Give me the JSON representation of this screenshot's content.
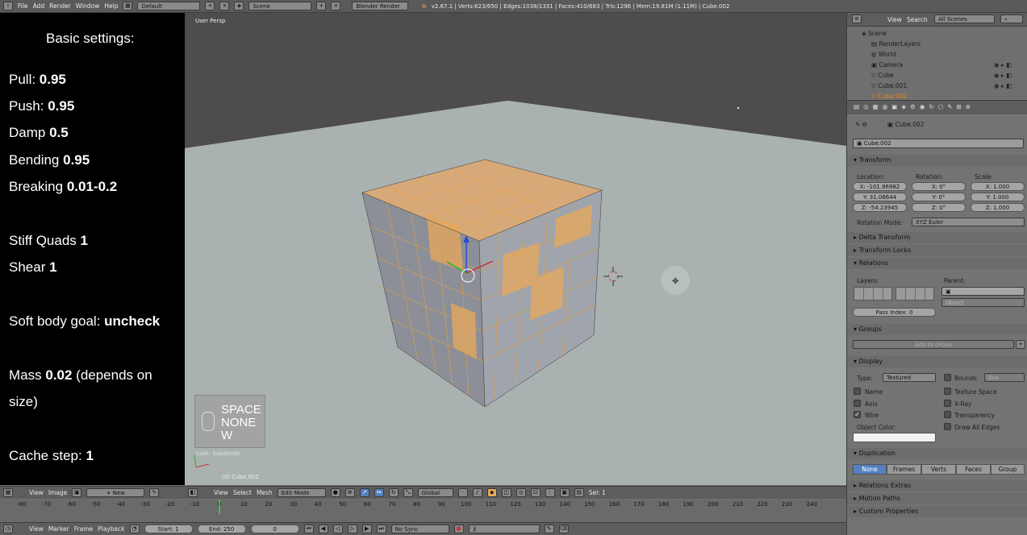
{
  "topbar": {
    "menus": [
      "File",
      "Add",
      "Render",
      "Window",
      "Help"
    ],
    "layout": "Default",
    "scene": "Scene",
    "engine": "Blender Render",
    "stats": "v2.67.1 | Verts:623/650 | Edges:1038/1331 | Faces:410/683 | Tris:1296 | Mem:19.81M (1.11M) | Cube.002"
  },
  "notes": {
    "heading": "Basic settings:",
    "lines": [
      {
        "label": "Pull: ",
        "value": "0.95"
      },
      {
        "label": "Push: ",
        "value": "0.95"
      },
      {
        "label": "Damp ",
        "value": "0.5"
      },
      {
        "label": "Bending ",
        "value": "0.95"
      },
      {
        "label": "Breaking ",
        "value": "0.01-0.2"
      },
      {
        "label": "Stiff Quads ",
        "value": "1"
      },
      {
        "label": "Shear ",
        "value": "1"
      },
      {
        "label": "Soft body goal: ",
        "value": "uncheck"
      },
      {
        "label": "Mass ",
        "value": "0.02",
        "suffix": " (depends on"
      },
      {
        "label": "size)",
        "value": ""
      },
      {
        "label": "Cache step: ",
        "value": "1"
      }
    ]
  },
  "viewport": {
    "label": "User Persp",
    "key_overlay": [
      "SPACE",
      "NONE",
      "W"
    ],
    "last_op": "Last: Subdivide",
    "object_label": "(0) Cube.002"
  },
  "outliner": {
    "menu_view": "View",
    "menu_search": "Search",
    "filter": "All Scenes",
    "items": [
      "Scene",
      "RenderLayers",
      "World",
      "Camera",
      "Cube",
      "Cube.001",
      "Cube.002"
    ]
  },
  "properties": {
    "breadcrumb": "Cube.002",
    "object_name": "Cube.002",
    "transform_title": "Transform",
    "location_label": "Location:",
    "rotation_label": "Rotation:",
    "scale_label": "Scale:",
    "location": [
      "X: -101.86982",
      "Y: 31.08644",
      "Z: -54.23945"
    ],
    "rotation": [
      "X: 0°",
      "Y: 0°",
      "Z: 0°"
    ],
    "scale": [
      "X: 1.000",
      "Y: 1.000",
      "Z: 1.000"
    ],
    "rotation_mode_label": "Rotation Mode:",
    "rotation_mode": "XYZ Euler",
    "delta_transform": "Delta Transform",
    "transform_locks": "Transform Locks",
    "relations_title": "Relations",
    "layers_label": "Layers:",
    "parent_label": "Parent:",
    "parent_type": "Object",
    "pass_index": "Pass Index: 0",
    "groups_title": "Groups",
    "add_to_group": "Add to Group",
    "display_title": "Display",
    "type_label": "Type:",
    "type_value": "Textured",
    "bounds": "Bounds",
    "bounds_type": "Box",
    "name": "Name",
    "texture_space": "Texture Space",
    "axis": "Axis",
    "xray": "X-Ray",
    "wire": "Wire",
    "transparency": "Transparency",
    "object_color": "Object Color:",
    "draw_all_edges": "Draw All Edges",
    "duplication_title": "Duplication",
    "dup_buttons": [
      "None",
      "Frames",
      "Verts",
      "Faces",
      "Group"
    ],
    "relations_extras": "Relations Extras",
    "motion_paths": "Motion Paths",
    "custom_properties": "Custom Properties"
  },
  "view3d_header": {
    "view": "View",
    "select": "Select",
    "mesh": "Mesh",
    "mode": "Edit Mode",
    "orientation": "Global",
    "sel": "Sel: 1"
  },
  "image_header": {
    "view": "View",
    "image": "Image",
    "new": "New"
  },
  "timeline": {
    "ticks": [
      "-80",
      "-70",
      "-60",
      "-50",
      "-40",
      "-30",
      "-20",
      "-10",
      "0",
      "10",
      "20",
      "30",
      "40",
      "50",
      "60",
      "70",
      "80",
      "90",
      "100",
      "110",
      "120",
      "130",
      "140",
      "150",
      "160",
      "170",
      "180",
      "190",
      "200",
      "210",
      "220",
      "230",
      "240"
    ],
    "current_frame": 0
  },
  "timeline_header": {
    "view": "View",
    "marker": "Marker",
    "frame": "Frame",
    "playback": "Playback",
    "start": "Start: 1",
    "end": "End: 250",
    "current": "0",
    "sync": "No Sync"
  },
  "colors": {
    "accent_orange": "#e8a85a",
    "selection_blue": "#5680c2",
    "timeline_green": "#45c045"
  }
}
